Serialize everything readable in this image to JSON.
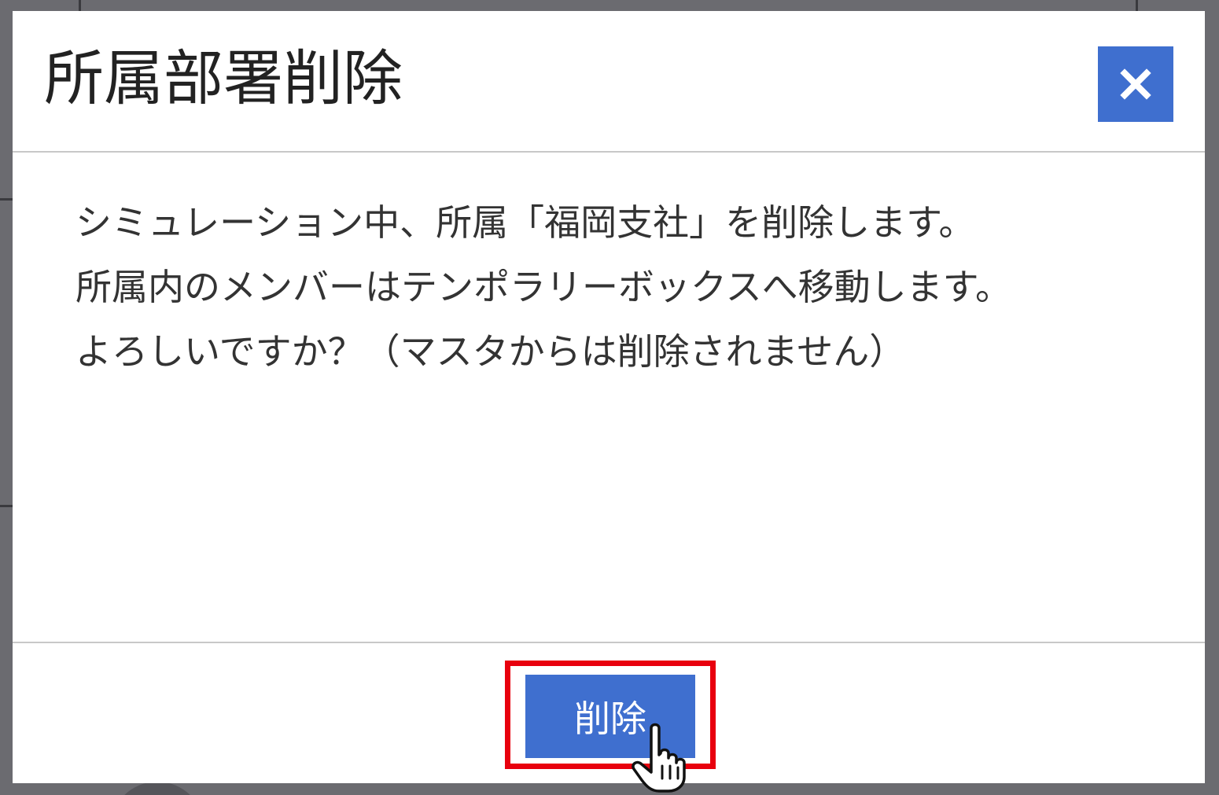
{
  "dialog": {
    "title": "所属部署削除",
    "close_icon": "close-icon",
    "message_lines": [
      "シミュレーション中、所属「福岡支社」を削除します。",
      "所属内のメンバーはテンポラリーボックスへ移動します。",
      "よろしいですか？（マスタからは削除されません）"
    ],
    "delete_label": "削除",
    "cursor_icon": "hand-pointer-icon"
  },
  "colors": {
    "accent": "#3f6fcf",
    "highlight": "#e8000e",
    "overlay": "#6b6b70"
  }
}
